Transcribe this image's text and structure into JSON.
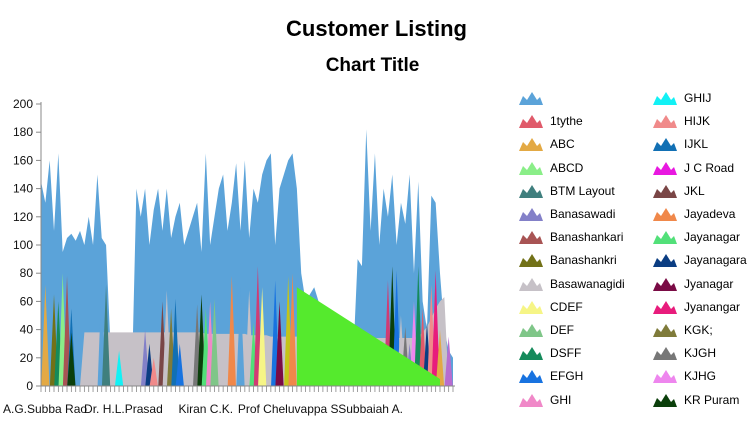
{
  "page": {
    "title": "Customer Listing"
  },
  "chart_data": {
    "type": "area",
    "title": "Chart Title",
    "xlabel": "",
    "ylabel": "",
    "ylim": [
      0,
      200
    ],
    "yticks": [
      0,
      20,
      40,
      60,
      80,
      100,
      120,
      140,
      160,
      180,
      200
    ],
    "x_tick_labels": [
      "A.G.Subba Rao",
      "Dr. H.L.Prasad",
      "Kiran C.K.",
      "Prof Cheluvappa S",
      "Subbaiah A."
    ],
    "legend_position": "right",
    "base_profile": [
      145,
      130,
      160,
      110,
      165,
      95,
      105,
      108,
      103,
      110,
      100,
      120,
      100,
      150,
      105,
      100,
      30,
      20,
      25,
      20,
      15,
      10,
      140,
      120,
      140,
      100,
      125,
      140,
      110,
      140,
      105,
      120,
      130,
      100,
      110,
      120,
      130,
      95,
      165,
      100,
      120,
      140,
      150,
      110,
      130,
      158,
      110,
      160,
      105,
      140,
      130,
      150,
      160,
      165,
      100,
      140,
      150,
      160,
      165,
      140,
      80,
      60,
      65,
      70,
      60,
      55,
      50,
      45,
      40,
      30,
      20,
      15,
      20,
      90,
      85,
      182,
      110,
      165,
      100,
      140,
      120,
      150,
      100,
      130,
      115,
      150,
      80,
      145,
      60,
      40,
      135,
      130,
      80,
      40,
      25,
      20
    ],
    "grey_profile": [
      0,
      0,
      0,
      0,
      0,
      0,
      0,
      0,
      0,
      0,
      38,
      38,
      38,
      38,
      38,
      38,
      38,
      38,
      38,
      38,
      38,
      38,
      38,
      38,
      38,
      38,
      38,
      38,
      38,
      38,
      38,
      38,
      38,
      38,
      38,
      38,
      38,
      38,
      37,
      37,
      37,
      37,
      37,
      37,
      37,
      37,
      37,
      37,
      36,
      36,
      36,
      36,
      36,
      35,
      35,
      35,
      35,
      35,
      35,
      35,
      35,
      35,
      35,
      34,
      34,
      34,
      34,
      34,
      34,
      34,
      34,
      34,
      34,
      34,
      34,
      34,
      34,
      34,
      34,
      34,
      34,
      34,
      34,
      34,
      34,
      34,
      34,
      35,
      38,
      42,
      48,
      55,
      60,
      63,
      0,
      0
    ],
    "green_triangle": {
      "start_index": 59,
      "end_index": 92,
      "start_value": 70,
      "end_value": 5
    },
    "spikes": [
      {
        "series_index": 2,
        "x_index": 1,
        "value": 72
      },
      {
        "series_index": 7,
        "x_index": 3,
        "value": 65
      },
      {
        "series_index": 11,
        "x_index": 4,
        "value": 60
      },
      {
        "series_index": 3,
        "x_index": 5,
        "value": 80
      },
      {
        "series_index": 6,
        "x_index": 6,
        "value": 78
      },
      {
        "series_index": 16,
        "x_index": 7,
        "value": 55
      },
      {
        "series_index": 27,
        "x_index": 7,
        "value": 38
      },
      {
        "series_index": 0,
        "x_index": 14,
        "value": 76
      },
      {
        "series_index": 4,
        "x_index": 15,
        "value": 72
      },
      {
        "series_index": 14,
        "x_index": 18,
        "value": 25
      },
      {
        "series_index": 5,
        "x_index": 24,
        "value": 40
      },
      {
        "series_index": 21,
        "x_index": 25,
        "value": 30
      },
      {
        "series_index": 15,
        "x_index": 26,
        "value": 20
      },
      {
        "series_index": 18,
        "x_index": 28,
        "value": 60
      },
      {
        "series_index": 8,
        "x_index": 29,
        "value": 68
      },
      {
        "series_index": 24,
        "x_index": 30,
        "value": 55
      },
      {
        "series_index": 16,
        "x_index": 31,
        "value": 62
      },
      {
        "series_index": 12,
        "x_index": 32,
        "value": 30
      },
      {
        "series_index": 25,
        "x_index": 36,
        "value": 58
      },
      {
        "series_index": 27,
        "x_index": 37,
        "value": 65
      },
      {
        "series_index": 20,
        "x_index": 38,
        "value": 55
      },
      {
        "series_index": 13,
        "x_index": 39,
        "value": 60
      },
      {
        "series_index": 10,
        "x_index": 40,
        "value": 62
      },
      {
        "series_index": 19,
        "x_index": 44,
        "value": 78
      },
      {
        "series_index": 0,
        "x_index": 46,
        "value": 70
      },
      {
        "series_index": 8,
        "x_index": 48,
        "value": 68
      },
      {
        "series_index": 20,
        "x_index": 49,
        "value": 45
      },
      {
        "series_index": 30,
        "x_index": 50,
        "value": 85
      },
      {
        "series_index": 9,
        "x_index": 51,
        "value": 70
      },
      {
        "series_index": 12,
        "x_index": 54,
        "value": 75
      },
      {
        "series_index": 22,
        "x_index": 55,
        "value": 60
      },
      {
        "series_index": 29,
        "x_index": 57,
        "value": 78
      },
      {
        "series_index": 19,
        "x_index": 58,
        "value": 80
      },
      {
        "series_index": 30,
        "x_index": 80,
        "value": 75
      },
      {
        "series_index": 27,
        "x_index": 81,
        "value": 85
      },
      {
        "series_index": 12,
        "x_index": 82,
        "value": 82
      },
      {
        "series_index": 8,
        "x_index": 83,
        "value": 50
      },
      {
        "series_index": 25,
        "x_index": 84,
        "value": 42
      },
      {
        "series_index": 5,
        "x_index": 85,
        "value": 30
      },
      {
        "series_index": 26,
        "x_index": 86,
        "value": 60
      },
      {
        "series_index": 11,
        "x_index": 87,
        "value": 85
      },
      {
        "series_index": 1,
        "x_index": 88,
        "value": 55
      },
      {
        "series_index": 21,
        "x_index": 89,
        "value": 45
      },
      {
        "series_index": 15,
        "x_index": 90,
        "value": 72
      },
      {
        "series_index": 23,
        "x_index": 91,
        "value": 82
      },
      {
        "series_index": 2,
        "x_index": 92,
        "value": 40
      },
      {
        "series_index": 31,
        "x_index": 94,
        "value": 35
      }
    ],
    "series": [
      {
        "name": "",
        "color": "#5ba3d9"
      },
      {
        "name": "1tythe",
        "color": "#e05a6a"
      },
      {
        "name": "ABC",
        "color": "#e3a944"
      },
      {
        "name": "ABCD",
        "color": "#8aee88"
      },
      {
        "name": "BTM Layout",
        "color": "#3f7f7e"
      },
      {
        "name": "Banasawadi",
        "color": "#8380c8"
      },
      {
        "name": "Banashankari",
        "color": "#a85454"
      },
      {
        "name": "Banashankri",
        "color": "#727117"
      },
      {
        "name": "Basawanagidi",
        "color": "#c6c1c7"
      },
      {
        "name": "CDEF",
        "color": "#f6f586"
      },
      {
        "name": "DEF",
        "color": "#7fc688"
      },
      {
        "name": "DSFF",
        "color": "#158a5b"
      },
      {
        "name": "EFGH",
        "color": "#1873e0"
      },
      {
        "name": "GHI",
        "color": "#f088c8"
      },
      {
        "name": "GHIJ",
        "color": "#12f1f5"
      },
      {
        "name": "HIJK",
        "color": "#f08a8a"
      },
      {
        "name": "IJKL",
        "color": "#1270b4"
      },
      {
        "name": "J C Road",
        "color": "#e818e0"
      },
      {
        "name": "JKL",
        "color": "#7a4646"
      },
      {
        "name": "Jayadeva",
        "color": "#f0884a"
      },
      {
        "name": "Jayanagar",
        "color": "#52e079"
      },
      {
        "name": "Jayanagara",
        "color": "#0b3d82"
      },
      {
        "name": "Jyanagar",
        "color": "#7a0b45"
      },
      {
        "name": "Jyanangar",
        "color": "#e81c7c"
      },
      {
        "name": "KGK;",
        "color": "#7f7b3a"
      },
      {
        "name": "KJGH",
        "color": "#777777"
      },
      {
        "name": "KJHG",
        "color": "#ee86ee"
      },
      {
        "name": "KR Puram",
        "color": "#0b3f0b"
      },
      {
        "name": "",
        "color": "#5a14c8"
      },
      {
        "name": "",
        "color": "#c4c418"
      },
      {
        "name": "",
        "color": "#d03c74"
      },
      {
        "name": "",
        "color": "#b86cd0"
      }
    ],
    "green_color": "#55ea2d",
    "legend_count": 28
  }
}
